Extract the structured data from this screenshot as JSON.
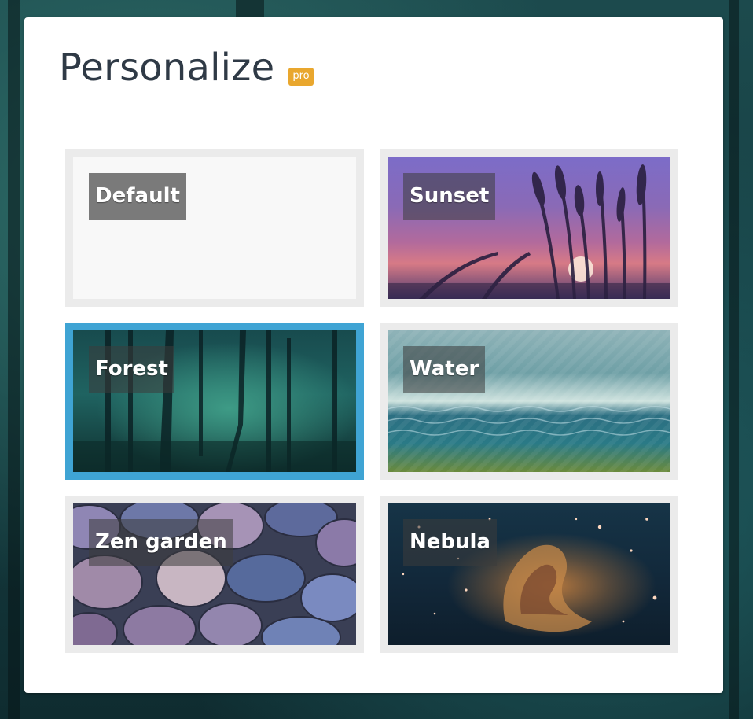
{
  "page": {
    "title": "Personalize",
    "badge": "pro"
  },
  "themes": [
    {
      "label": "Default",
      "selected": false
    },
    {
      "label": "Sunset",
      "selected": false
    },
    {
      "label": "Forest",
      "selected": true
    },
    {
      "label": "Water",
      "selected": false
    },
    {
      "label": "Zen garden",
      "selected": false
    },
    {
      "label": "Nebula",
      "selected": false
    }
  ],
  "colors": {
    "selected_border": "#3fa4d4",
    "badge": "#e9a72e",
    "title": "#2f3a46",
    "tile_border": "#ebebeb"
  }
}
